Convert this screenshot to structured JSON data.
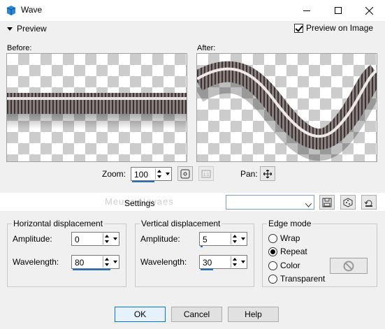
{
  "window": {
    "title": "Wave"
  },
  "preview": {
    "toggle_label": "Preview",
    "preview_on_image_label": "Preview on Image",
    "preview_on_image_checked": true,
    "before_label": "Before:",
    "after_label": "After:"
  },
  "zoom": {
    "label": "Zoom:",
    "value": "100",
    "pan_label": "Pan:"
  },
  "settings": {
    "label": "Settings",
    "watermark": "Meusa Novaes",
    "selected": ""
  },
  "horizontal": {
    "title": "Horizontal displacement",
    "amplitude_label": "Amplitude:",
    "amplitude": "0",
    "wavelength_label": "Wavelength:",
    "wavelength": "80"
  },
  "vertical": {
    "title": "Vertical displacement",
    "amplitude_label": "Amplitude:",
    "amplitude": "5",
    "wavelength_label": "Wavelength:",
    "wavelength": "30"
  },
  "edge_mode": {
    "title": "Edge mode",
    "options": [
      "Wrap",
      "Repeat",
      "Color",
      "Transparent"
    ],
    "selected": "Repeat"
  },
  "buttons": {
    "ok": "OK",
    "cancel": "Cancel",
    "help": "Help"
  },
  "colors": {
    "accent": "#0078d7",
    "checker": "#cccccc"
  }
}
